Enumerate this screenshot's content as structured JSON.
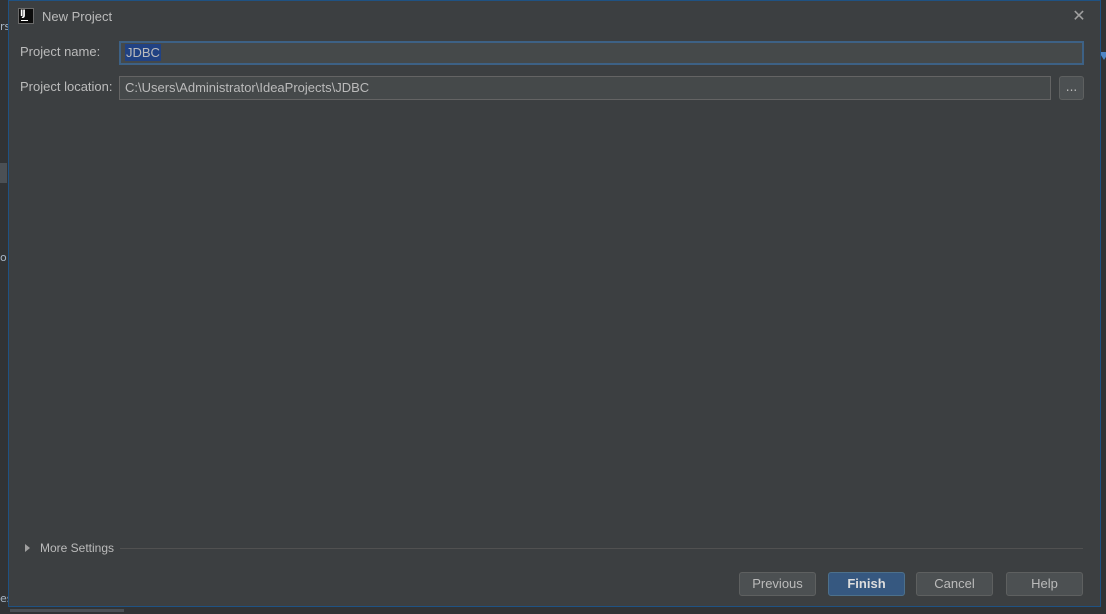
{
  "dialog": {
    "title": "New Project",
    "close_glyph": "✕",
    "app_icon_text": "IJ"
  },
  "form": {
    "name_label": "Project name:",
    "name_value": "JDBC",
    "location_label": "Project location:",
    "location_value": "C:\\Users\\Administrator\\IdeaProjects\\JDBC",
    "browse_label": "..."
  },
  "more_settings": {
    "label": "More Settings"
  },
  "buttons": {
    "previous": "Previous",
    "finish": "Finish",
    "cancel": "Cancel",
    "help": "Help"
  },
  "background_fragments": {
    "left_top": "rs",
    "left_mid": "o",
    "left_bottom": "es"
  },
  "colors": {
    "dialog_bg": "#3c3f41",
    "accent_border": "#1f5283",
    "primary_button": "#365880",
    "selection": "#214283"
  },
  "icons": {
    "app": "intellij-idea-icon",
    "close": "close-icon",
    "expand": "triangle-right-icon"
  }
}
